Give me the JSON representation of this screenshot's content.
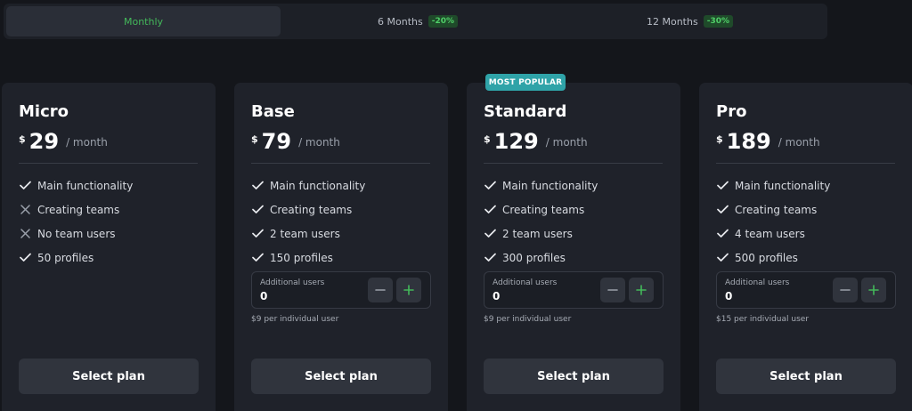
{
  "billing_periods": [
    {
      "label": "Monthly",
      "discount": ""
    },
    {
      "label": "6 Months",
      "discount": "-20%"
    },
    {
      "label": "12 Months",
      "discount": "-30%"
    }
  ],
  "selected_period": "Monthly",
  "badge": "MOST POPULAR",
  "currency_symbol": "$",
  "price_suffix": "/ month",
  "additional_users_label": "Additional users",
  "select_label": "Select plan",
  "colors": {
    "accent": "#43b85a",
    "badge": "#2fa3a8",
    "card": "#1f222a",
    "background": "#14161b"
  },
  "plans": [
    {
      "name": "Micro",
      "price": "29",
      "features": [
        {
          "text": "Main functionality",
          "icon": "check-icon"
        },
        {
          "text": "Creating teams",
          "icon": "cross-icon"
        },
        {
          "text": "No team users",
          "icon": "cross-icon"
        },
        {
          "text": "50 profiles",
          "icon": "check-icon"
        }
      ]
    },
    {
      "name": "Base",
      "price": "79",
      "features": [
        {
          "text": "Main functionality",
          "icon": "check-icon"
        },
        {
          "text": "Creating teams",
          "icon": "check-icon"
        },
        {
          "text": "2 team users",
          "icon": "check-icon"
        },
        {
          "text": "150 profiles",
          "icon": "check-icon"
        }
      ],
      "additional_users": "0",
      "per_user": "$9 per individual user"
    },
    {
      "name": "Standard",
      "price": "129",
      "features": [
        {
          "text": "Main functionality",
          "icon": "check-icon"
        },
        {
          "text": "Creating teams",
          "icon": "check-icon"
        },
        {
          "text": "2 team users",
          "icon": "check-icon"
        },
        {
          "text": "300 profiles",
          "icon": "check-icon"
        }
      ],
      "additional_users": "0",
      "per_user": "$9 per individual user"
    },
    {
      "name": "Pro",
      "price": "189",
      "features": [
        {
          "text": "Main functionality",
          "icon": "check-icon"
        },
        {
          "text": "Creating teams",
          "icon": "check-icon"
        },
        {
          "text": "4 team users",
          "icon": "check-icon"
        },
        {
          "text": "500 profiles",
          "icon": "check-icon"
        }
      ],
      "additional_users": "0",
      "per_user": "$15 per individual user"
    }
  ]
}
